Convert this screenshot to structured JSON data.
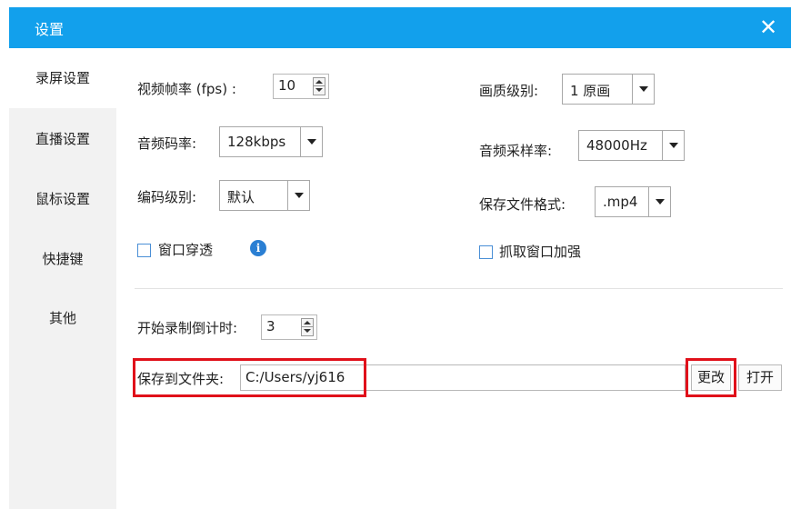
{
  "window": {
    "title": "设置"
  },
  "sidebar": {
    "items": [
      {
        "label": "录屏设置"
      },
      {
        "label": "直播设置"
      },
      {
        "label": "鼠标设置"
      },
      {
        "label": "快捷键"
      },
      {
        "label": "其他"
      }
    ],
    "active_index": 0
  },
  "settings": {
    "fps": {
      "label": "视频帧率 (fps) :",
      "value": "10"
    },
    "quality": {
      "label": "画质级别:",
      "value": "1 原画"
    },
    "audio_bitrate": {
      "label": "音频码率:",
      "value": "128kbps"
    },
    "sample_rate": {
      "label": "音频采样率:",
      "value": "48000Hz"
    },
    "encode_level": {
      "label": "编码级别:",
      "value": "默认"
    },
    "file_format": {
      "label": "保存文件格式:",
      "value": ".mp4"
    },
    "window_through": {
      "label": "窗口穿透",
      "checked": false
    },
    "capture_enhance": {
      "label": "抓取窗口加强",
      "checked": false
    },
    "countdown": {
      "label": "开始录制倒计时:",
      "value": "3"
    },
    "save_folder": {
      "label": "保存到文件夹:",
      "value": "C:/Users/yj616"
    }
  },
  "buttons": {
    "change": "更改",
    "open": "打开"
  },
  "colors": {
    "titlebar": "#12a0ec",
    "sidebar": "#f2f2f2",
    "highlight": "#e0101a",
    "info_icon": "#2a7fd3"
  }
}
